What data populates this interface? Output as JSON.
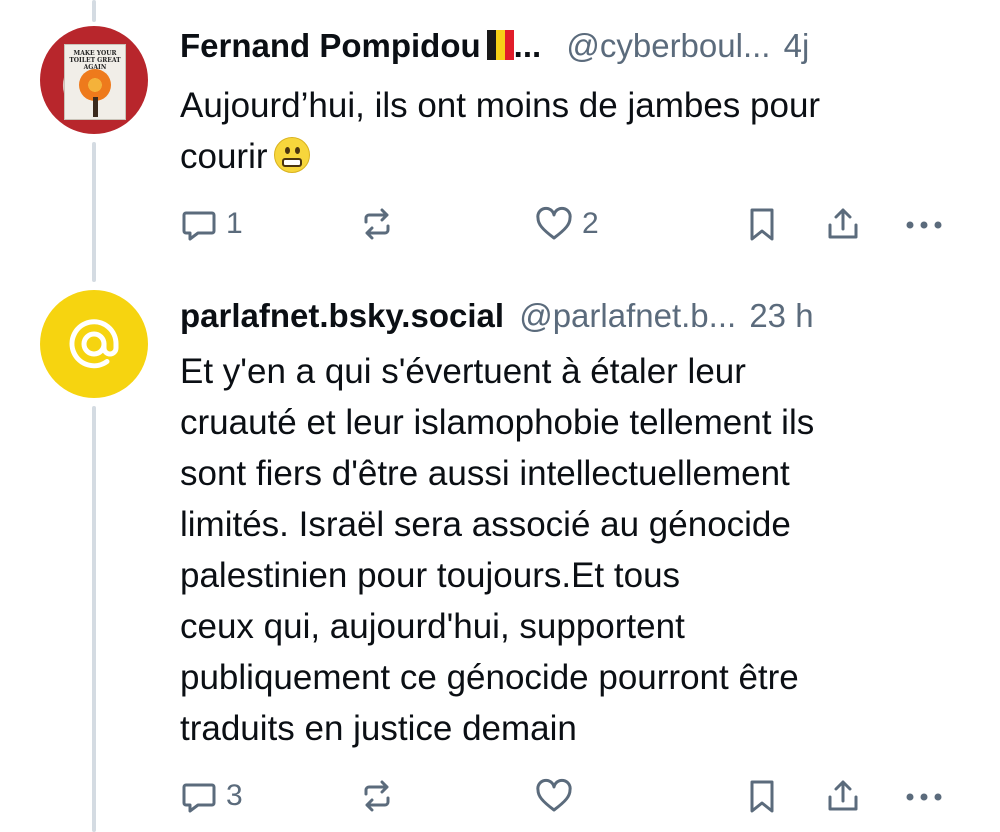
{
  "posts": [
    {
      "author": {
        "display_name": "Fernand Pompidou",
        "name_suffix": "...",
        "handle": "@cyberboul...",
        "avatar_sign_text": "MAKE YOUR TOILET GREAT AGAIN"
      },
      "timestamp": "4j",
      "text": "Aujourd’hui, ils ont moins de jambes pour\ncourir",
      "emoji": "grimacing-face",
      "reply_count": "1",
      "like_count": "2",
      "flag_colors": [
        "#1a1a1a",
        "#f7d117",
        "#e11d2a"
      ]
    },
    {
      "author": {
        "display_name": "parlafnet.bsky.social",
        "handle": "@parlafnet.b...",
        "avatar_symbol": "@"
      },
      "timestamp": "23 h",
      "text": "Et y'en a qui s'évertuent à étaler leur\ncruauté et leur islamophobie tellement ils\nsont fiers d'être aussi intellectuellement\nlimités. Israël sera associé au génocide\npalestinien pour toujours.Et tous\nceux qui, aujourd'hui, supportent\npubliquement ce génocide pourront être\ntraduits en justice demain",
      "reply_count": "3"
    }
  ],
  "icons": [
    "reply-icon",
    "repost-icon",
    "like-icon",
    "bookmark-icon",
    "share-icon",
    "more-icon"
  ],
  "colors": {
    "text": "#0b0f14",
    "muted": "#5b6b7c",
    "thread_line": "#d4dbe2",
    "avatar_yellow": "#f6d410"
  }
}
